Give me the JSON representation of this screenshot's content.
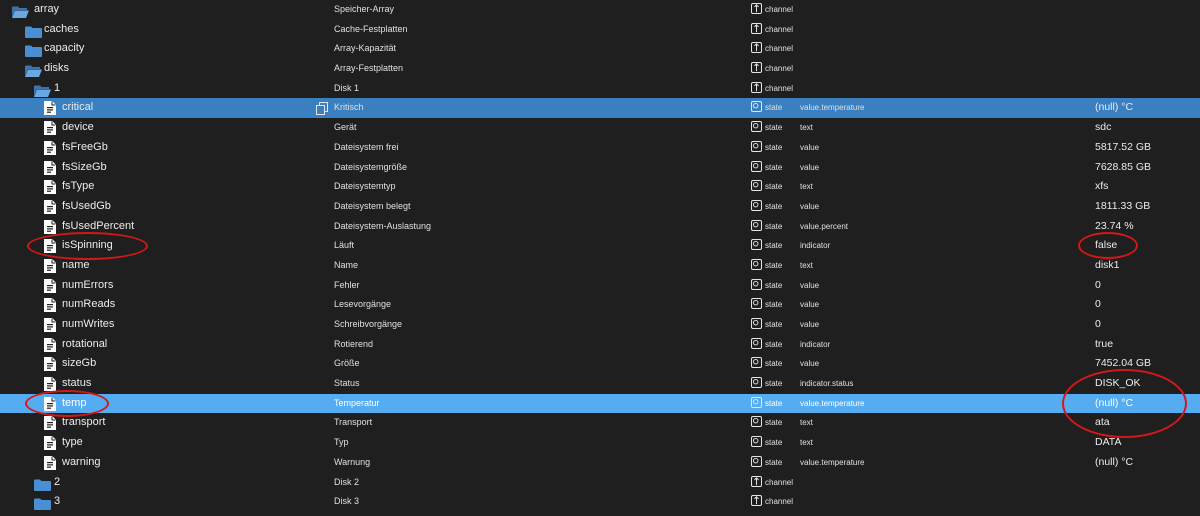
{
  "rows": [
    {
      "name": "array",
      "desc": "Speicher-Array",
      "type": "channel",
      "role": "",
      "value": "",
      "kind": "folder-open",
      "indent": 0,
      "sel": ""
    },
    {
      "name": "caches",
      "desc": "Cache-Festplatten",
      "type": "channel",
      "role": "",
      "value": "",
      "kind": "folder",
      "indent": 1,
      "sel": ""
    },
    {
      "name": "capacity",
      "desc": "Array-Kapazität",
      "type": "channel",
      "role": "",
      "value": "",
      "kind": "folder",
      "indent": 1,
      "sel": ""
    },
    {
      "name": "disks",
      "desc": "Array-Festplatten",
      "type": "channel",
      "role": "",
      "value": "",
      "kind": "folder-open",
      "indent": 1,
      "sel": ""
    },
    {
      "name": "1",
      "desc": "Disk 1",
      "type": "channel",
      "role": "",
      "value": "",
      "kind": "folder-open",
      "indent": 2,
      "sel": ""
    },
    {
      "name": "critical",
      "desc": "Kritisch",
      "type": "state",
      "role": "value.temperature",
      "value": "(null) °C",
      "kind": "file",
      "indent": 3,
      "sel": "sel1"
    },
    {
      "name": "device",
      "desc": "Gerät",
      "type": "state",
      "role": "text",
      "value": "sdc",
      "kind": "file",
      "indent": 3,
      "sel": ""
    },
    {
      "name": "fsFreeGb",
      "desc": "Dateisystem frei",
      "type": "state",
      "role": "value",
      "value": "5817.52 GB",
      "kind": "file",
      "indent": 3,
      "sel": ""
    },
    {
      "name": "fsSizeGb",
      "desc": "Dateisystemgröße",
      "type": "state",
      "role": "value",
      "value": "7628.85 GB",
      "kind": "file",
      "indent": 3,
      "sel": ""
    },
    {
      "name": "fsType",
      "desc": "Dateisystemtyp",
      "type": "state",
      "role": "text",
      "value": "xfs",
      "kind": "file",
      "indent": 3,
      "sel": ""
    },
    {
      "name": "fsUsedGb",
      "desc": "Dateisystem belegt",
      "type": "state",
      "role": "value",
      "value": "1811.33 GB",
      "kind": "file",
      "indent": 3,
      "sel": ""
    },
    {
      "name": "fsUsedPercent",
      "desc": "Dateisystem-Auslastung",
      "type": "state",
      "role": "value.percent",
      "value": "23.74 %",
      "kind": "file",
      "indent": 3,
      "sel": ""
    },
    {
      "name": "isSpinning",
      "desc": "Läuft",
      "type": "state",
      "role": "indicator",
      "value": "false",
      "kind": "file",
      "indent": 3,
      "sel": ""
    },
    {
      "name": "name",
      "desc": "Name",
      "type": "state",
      "role": "text",
      "value": "disk1",
      "kind": "file",
      "indent": 3,
      "sel": ""
    },
    {
      "name": "numErrors",
      "desc": "Fehler",
      "type": "state",
      "role": "value",
      "value": "0",
      "kind": "file",
      "indent": 3,
      "sel": ""
    },
    {
      "name": "numReads",
      "desc": "Lesevorgänge",
      "type": "state",
      "role": "value",
      "value": "0",
      "kind": "file",
      "indent": 3,
      "sel": ""
    },
    {
      "name": "numWrites",
      "desc": "Schreibvorgänge",
      "type": "state",
      "role": "value",
      "value": "0",
      "kind": "file",
      "indent": 3,
      "sel": ""
    },
    {
      "name": "rotational",
      "desc": "Rotierend",
      "type": "state",
      "role": "indicator",
      "value": "true",
      "kind": "file",
      "indent": 3,
      "sel": ""
    },
    {
      "name": "sizeGb",
      "desc": "Größe",
      "type": "state",
      "role": "value",
      "value": "7452.04 GB",
      "kind": "file",
      "indent": 3,
      "sel": ""
    },
    {
      "name": "status",
      "desc": "Status",
      "type": "state",
      "role": "indicator.status",
      "value": "DISK_OK",
      "kind": "file",
      "indent": 3,
      "sel": ""
    },
    {
      "name": "temp",
      "desc": "Temperatur",
      "type": "state",
      "role": "value.temperature",
      "value": "(null) °C",
      "kind": "file",
      "indent": 3,
      "sel": "sel2"
    },
    {
      "name": "transport",
      "desc": "Transport",
      "type": "state",
      "role": "text",
      "value": "ata",
      "kind": "file",
      "indent": 3,
      "sel": ""
    },
    {
      "name": "type",
      "desc": "Typ",
      "type": "state",
      "role": "text",
      "value": "DATA",
      "kind": "file",
      "indent": 3,
      "sel": ""
    },
    {
      "name": "warning",
      "desc": "Warnung",
      "type": "state",
      "role": "value.temperature",
      "value": "(null) °C",
      "kind": "file",
      "indent": 3,
      "sel": ""
    },
    {
      "name": "2",
      "desc": "Disk 2",
      "type": "channel",
      "role": "",
      "value": "",
      "kind": "folder",
      "indent": 2,
      "sel": ""
    },
    {
      "name": "3",
      "desc": "Disk 3",
      "type": "channel",
      "role": "",
      "value": "",
      "kind": "folder",
      "indent": 2,
      "sel": ""
    }
  ],
  "colors": {
    "background": "#1f1f1f",
    "selected_row": "#3a7fc0",
    "highlight_row": "#56acf1",
    "folder_icon": "#4a8fd4",
    "annotation": "#d21818"
  },
  "icons": {
    "folder": "folder-icon",
    "folder_open": "folder-open-icon",
    "file": "file-icon",
    "channel": "channel-icon",
    "state": "state-icon",
    "copy": "copy-icon"
  }
}
